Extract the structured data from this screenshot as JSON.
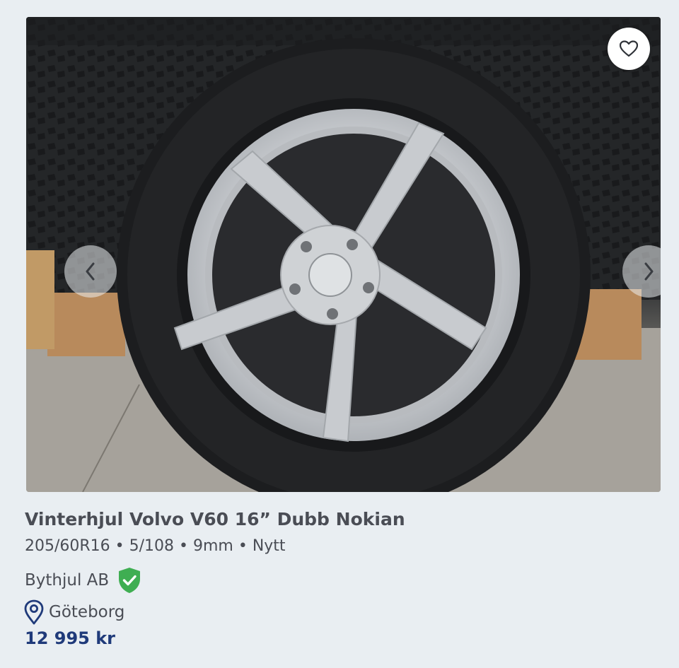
{
  "listing": {
    "title": "Vinterhjul Volvo V60 16” Dubb Nokian",
    "specs": "205/60R16 • 5/108 • 9mm • Nytt",
    "seller": "Bythjul AB",
    "seller_verified": true,
    "location": "Göteborg",
    "price": "12 995 kr"
  },
  "image": {
    "description_icon": "tire-photo",
    "favorite_icon": "heart-outline-icon",
    "prev_icon": "chevron-left-icon",
    "next_icon": "chevron-right-icon"
  },
  "colors": {
    "background": "#e9eef2",
    "text": "#4a4d55",
    "price": "#1f3a7a",
    "verified_badge": "#3fae52",
    "location_icon": "#1f3a7a"
  }
}
